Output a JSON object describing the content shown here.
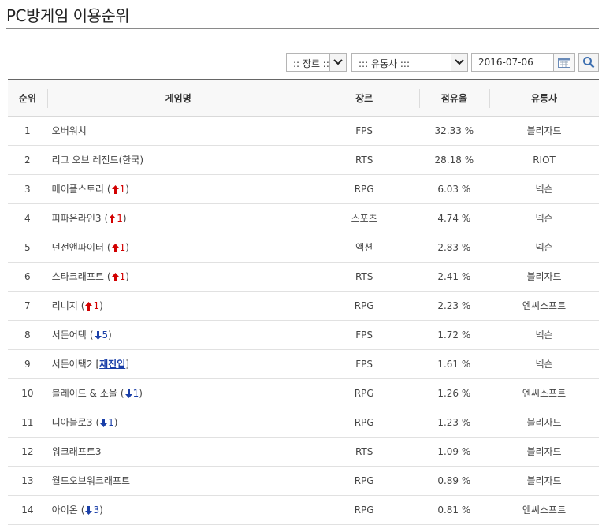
{
  "page": {
    "title": "PC방게임 이용순위"
  },
  "filters": {
    "genre_value": ":: 장르 ::",
    "publisher_value": "::: 유통사 :::",
    "date_value": "2016-07-06"
  },
  "table": {
    "headers": {
      "rank": "순위",
      "name": "게임명",
      "genre": "장르",
      "share": "점유율",
      "publisher": "유통사"
    },
    "rows": [
      {
        "rank": "1",
        "name": "오버워치",
        "genre": "FPS",
        "share": "32.33 %",
        "publisher": "블리자드",
        "change": null
      },
      {
        "rank": "2",
        "name": "리그 오브 레전드(한국)",
        "genre": "RTS",
        "share": "28.18 %",
        "publisher": "RIOT",
        "change": null
      },
      {
        "rank": "3",
        "name": "메이플스토리",
        "genre": "RPG",
        "share": "6.03 %",
        "publisher": "넥슨",
        "change": {
          "dir": "up",
          "num": "1"
        }
      },
      {
        "rank": "4",
        "name": "피파온라인3",
        "genre": "스포츠",
        "share": "4.74 %",
        "publisher": "넥슨",
        "change": {
          "dir": "up",
          "num": "1"
        }
      },
      {
        "rank": "5",
        "name": "던전앤파이터",
        "genre": "액션",
        "share": "2.83 %",
        "publisher": "넥슨",
        "change": {
          "dir": "up",
          "num": "1"
        }
      },
      {
        "rank": "6",
        "name": "스타크래프트",
        "genre": "RTS",
        "share": "2.41 %",
        "publisher": "블리자드",
        "change": {
          "dir": "up",
          "num": "1"
        }
      },
      {
        "rank": "7",
        "name": "리니지",
        "genre": "RPG",
        "share": "2.23 %",
        "publisher": "엔씨소프트",
        "change": {
          "dir": "up",
          "num": "1"
        }
      },
      {
        "rank": "8",
        "name": "서든어택",
        "genre": "FPS",
        "share": "1.72 %",
        "publisher": "넥슨",
        "change": {
          "dir": "down",
          "num": "5"
        }
      },
      {
        "rank": "9",
        "name": "서든어택2",
        "genre": "FPS",
        "share": "1.61 %",
        "publisher": "넥슨",
        "change": {
          "dir": "reentry",
          "text": "재진입"
        }
      },
      {
        "rank": "10",
        "name": "블레이드 & 소울",
        "genre": "RPG",
        "share": "1.26 %",
        "publisher": "엔씨소프트",
        "change": {
          "dir": "down",
          "num": "1"
        }
      },
      {
        "rank": "11",
        "name": "디아블로3",
        "genre": "RPG",
        "share": "1.23 %",
        "publisher": "블리자드",
        "change": {
          "dir": "down",
          "num": "1"
        }
      },
      {
        "rank": "12",
        "name": "워크래프트3",
        "genre": "RTS",
        "share": "1.09 %",
        "publisher": "블리자드",
        "change": null
      },
      {
        "rank": "13",
        "name": "월드오브워크래프트",
        "genre": "RPG",
        "share": "0.89 %",
        "publisher": "블리자드",
        "change": null
      },
      {
        "rank": "14",
        "name": "아이온",
        "genre": "RPG",
        "share": "0.81 %",
        "publisher": "엔씨소프트",
        "change": {
          "dir": "down",
          "num": "3"
        }
      }
    ]
  },
  "colors": {
    "up": "#d20000",
    "down": "#1a3fa8",
    "header_bg": "#f8f8f8"
  }
}
